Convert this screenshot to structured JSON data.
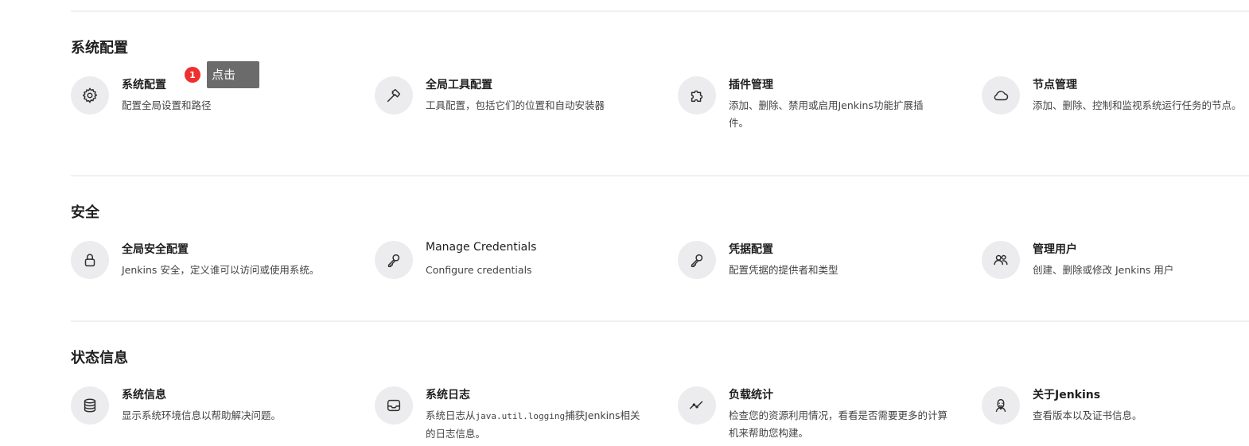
{
  "sections": [
    {
      "title": "系统配置",
      "items": [
        {
          "title": "系统配置",
          "desc": "配置全局设置和路径",
          "icon": "gear-icon"
        },
        {
          "title": "全局工具配置",
          "desc": "工具配置，包括它们的位置和自动安装器",
          "icon": "hammer-icon"
        },
        {
          "title": "插件管理",
          "desc": "添加、删除、禁用或启用Jenkins功能扩展插件。",
          "icon": "puzzle-icon"
        },
        {
          "title": "节点管理",
          "desc": "添加、删除、控制和监视系统运行任务的节点。",
          "icon": "cloud-icon"
        }
      ]
    },
    {
      "title": "安全",
      "items": [
        {
          "title": "全局安全配置",
          "desc": "Jenkins 安全，定义谁可以访问或使用系统。",
          "icon": "lock-icon"
        },
        {
          "title": "Manage Credentials",
          "desc": "Configure credentials",
          "icon": "key-icon"
        },
        {
          "title": "凭据配置",
          "desc": "配置凭据的提供者和类型",
          "icon": "key-icon"
        },
        {
          "title": "管理用户",
          "desc": "创建、删除或修改 Jenkins 用户",
          "icon": "users-icon"
        }
      ]
    },
    {
      "title": "状态信息",
      "items": [
        {
          "title": "系统信息",
          "desc": "显示系统环境信息以帮助解决问题。",
          "icon": "database-icon"
        },
        {
          "title": "系统日志",
          "desc_before": "系统日志从",
          "desc_code": "java.util.logging",
          "desc_after": "捕获Jenkins相关的日志信息。",
          "icon": "inbox-icon"
        },
        {
          "title": "负载统计",
          "desc": "检查您的资源利用情况，看看是否需要更多的计算机来帮助您构建。",
          "icon": "trend-icon"
        },
        {
          "title": "关于Jenkins",
          "desc": "查看版本以及证书信息。",
          "icon": "jenkins-butler-icon"
        }
      ]
    }
  ],
  "annotation": {
    "badge_number": "1",
    "tooltip_text": "点击"
  }
}
